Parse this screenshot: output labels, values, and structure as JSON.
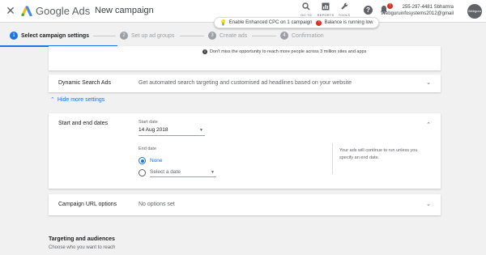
{
  "header": {
    "brand": "Google Ads",
    "title": "New campaign",
    "tools": [
      {
        "label": "GO TO",
        "icon": "search-icon"
      },
      {
        "label": "REPORTS",
        "icon": "reports-icon"
      },
      {
        "label": "TOOLS",
        "icon": "wrench-icon"
      }
    ],
    "notification_count": "!",
    "account_phone": "255-297-4481 Sbhamra",
    "account_email": "Webguruinfosystems2012@gmail",
    "avatar_text": "Webguru"
  },
  "notifications": {
    "cpc": "Enable Enhanced CPC on 1 campaign",
    "balance": "Balance is running low"
  },
  "steps": [
    {
      "num": "1",
      "label": "Select campaign settings"
    },
    {
      "num": "2",
      "label": "Set up ad groups"
    },
    {
      "num": "3",
      "label": "Create ads"
    },
    {
      "num": "4",
      "label": "Confirmation"
    }
  ],
  "network_card": {
    "hint": "Don't miss the opportunity to reach more people across 3 million sites and apps"
  },
  "dynamic_search": {
    "title": "Dynamic Search Ads",
    "desc": "Get automated search targeting and customised ad headlines based on your website"
  },
  "hide_more": "Hide more settings",
  "dates": {
    "title": "Start and end dates",
    "start_label": "Start date",
    "start_value": "14 Aug 2018",
    "end_label": "End date",
    "end_none": "None",
    "end_select": "Select a date",
    "note": "Your ads will continue to run unless you specify an end date."
  },
  "url_options": {
    "title": "Campaign URL options",
    "desc": "No options set"
  },
  "targeting": {
    "title": "Targeting and audiences",
    "subtitle": "Choose who you want to reach"
  }
}
